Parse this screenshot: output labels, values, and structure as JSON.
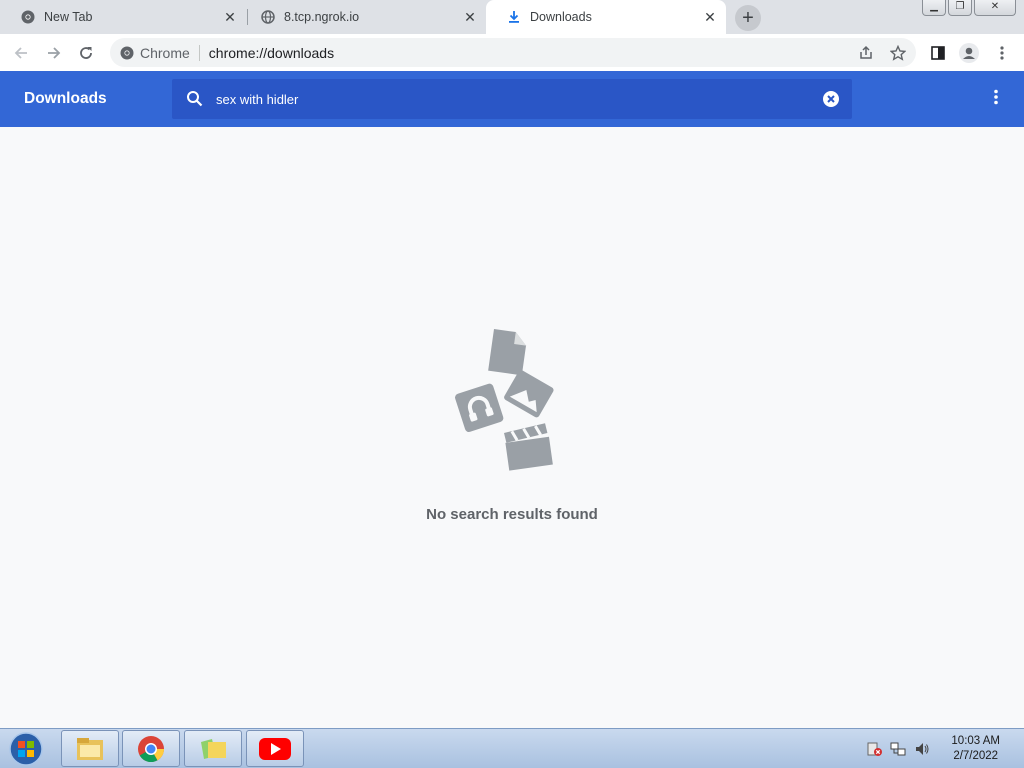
{
  "tabs": [
    {
      "title": "New Tab",
      "icon": "chrome-icon",
      "active": false
    },
    {
      "title": "8.tcp.ngrok.io",
      "icon": "globe-icon",
      "active": false
    },
    {
      "title": "Downloads",
      "icon": "download-icon",
      "active": true
    }
  ],
  "omnibox": {
    "chip": "Chrome",
    "url": "chrome://downloads"
  },
  "downloads": {
    "title": "Downloads",
    "search_value": "sex with hidler",
    "empty_message": "No search results found"
  },
  "taskbar": {
    "time": "10:03 AM",
    "date": "2/7/2022",
    "apps": [
      "explorer-icon",
      "chrome-icon",
      "folder-icon",
      "youtube-icon"
    ]
  },
  "colors": {
    "header": "#3367d6",
    "search_bg": "#2a56c6",
    "page_bg": "#f8f9fa"
  }
}
